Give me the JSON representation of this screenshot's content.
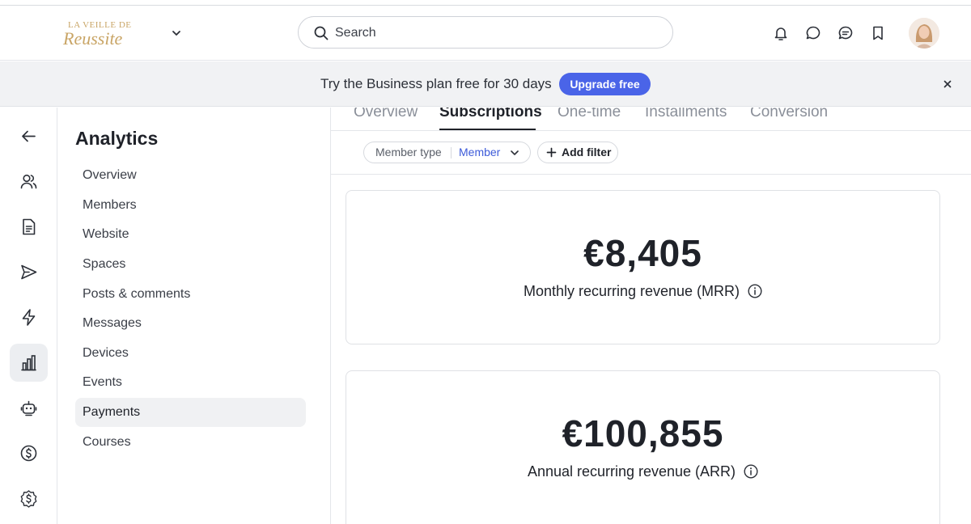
{
  "header": {
    "logo_text_top": "LA VEILLE DE",
    "logo_text_main": "Reussite",
    "search_placeholder": "Search",
    "icons": [
      "bell-icon",
      "chat-bubble-icon",
      "messages-icon",
      "bookmark-icon"
    ]
  },
  "banner": {
    "text": "Try the Business plan free for 30 days",
    "button": "Upgrade free",
    "accent": "#4a64e8"
  },
  "rail": {
    "icons": [
      "back-arrow-icon",
      "members-icon",
      "document-icon",
      "send-icon",
      "lightning-icon",
      "analytics-icon",
      "bot-icon",
      "dollar-icon",
      "dollar-badge-icon"
    ],
    "active": "analytics-icon"
  },
  "nav": {
    "title": "Analytics",
    "items": [
      {
        "label": "Overview"
      },
      {
        "label": "Members"
      },
      {
        "label": "Website"
      },
      {
        "label": "Spaces"
      },
      {
        "label": "Posts & comments"
      },
      {
        "label": "Messages"
      },
      {
        "label": "Devices"
      },
      {
        "label": "Events"
      },
      {
        "label": "Payments"
      },
      {
        "label": "Courses"
      }
    ],
    "active": "Payments"
  },
  "tabs": [
    {
      "label": "Overview"
    },
    {
      "label": "Subscriptions"
    },
    {
      "label": "One-time"
    },
    {
      "label": "Installments"
    },
    {
      "label": "Conversion"
    }
  ],
  "active_tab": "Subscriptions",
  "filters": {
    "member_type_key": "Member type",
    "member_type_value": "Member",
    "add_filter": "Add filter"
  },
  "metrics": [
    {
      "value": "€8,405",
      "label": "Monthly recurring revenue (MRR)"
    },
    {
      "value": "€100,855",
      "label": "Annual recurring revenue (ARR)"
    }
  ]
}
